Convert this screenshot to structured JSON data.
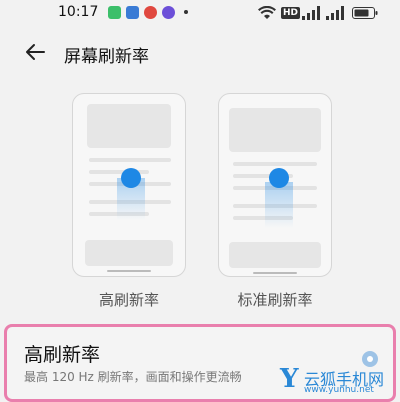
{
  "status_bar": {
    "time": "10:17",
    "hd_label": "HD",
    "icons": [
      "app-icon-green",
      "app-icon-blue",
      "app-icon-weibo",
      "app-icon-purple"
    ]
  },
  "header": {
    "title": "屏幕刷新率",
    "back_icon": "arrow-left-icon"
  },
  "previews": [
    {
      "label": "高刷新率"
    },
    {
      "label": "标准刷新率"
    }
  ],
  "option": {
    "title": "高刷新率",
    "subtitle": "最高 120 Hz 刷新率，画面和操作更流畅",
    "selected": true
  },
  "watermark": {
    "logo": "Y",
    "name": "云狐手机网",
    "url": "www.yunhu.net"
  },
  "colors": {
    "accent": "#1e88e5",
    "highlight_border": "#e97fad",
    "background": "#f2f2f2"
  }
}
